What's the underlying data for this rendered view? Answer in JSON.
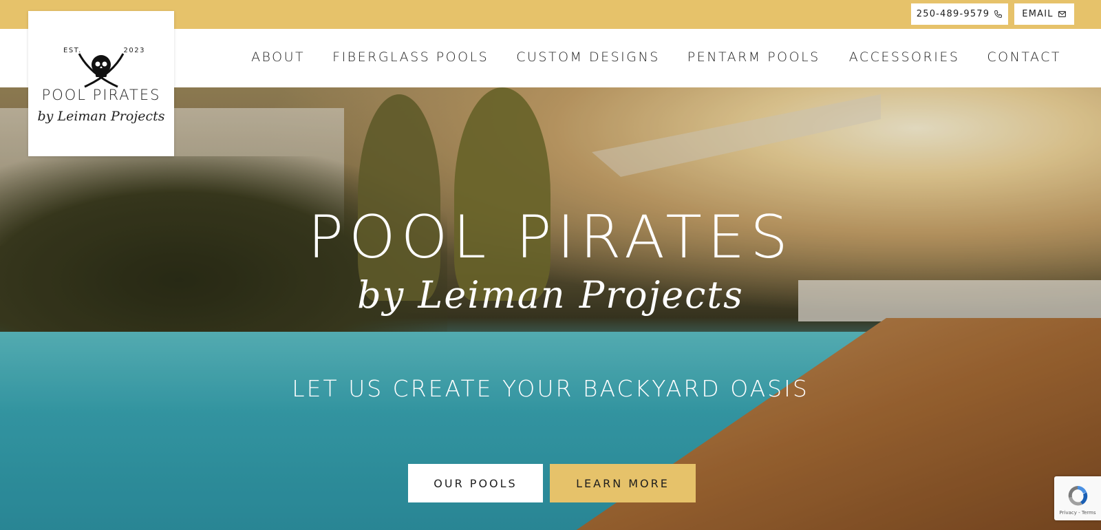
{
  "topbar": {
    "phone": "250-489-9579",
    "email": "EMAIL",
    "bg_color": "#e6c26a",
    "phone_icon": "phone-icon",
    "email_icon": "mail-icon"
  },
  "logo": {
    "est": "EST.",
    "year": "2023",
    "name": "POOL PIRATES",
    "by": "by Leiman Projects",
    "emblem": "skull-crossed-swords-icon"
  },
  "nav": {
    "items": [
      "ABOUT",
      "FIBERGLASS POOLS",
      "CUSTOM DESIGNS",
      "PENTARM POOLS",
      "ACCESSORIES",
      "CONTACT"
    ]
  },
  "hero": {
    "title": "POOL PIRATES",
    "script": "by Leiman Projects",
    "tagline": "LET US CREATE YOUR BACKYARD OASIS",
    "primary_button": "OUR POOLS",
    "secondary_button": "LEARN MORE",
    "accent_color": "#e6c26a"
  },
  "recaptcha": {
    "text": "Privacy - Terms",
    "icon": "recaptcha-icon"
  }
}
